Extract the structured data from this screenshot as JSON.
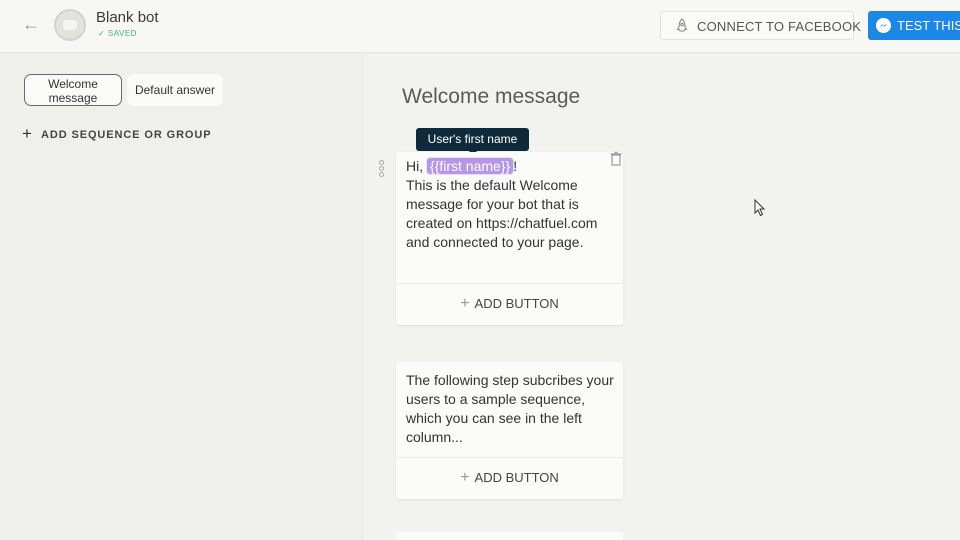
{
  "header": {
    "back_label": "←",
    "bot_name": "Blank bot",
    "saved_status": "✓ SAVED",
    "connect_label": "CONNECT TO FACEBOOK",
    "test_label": "TEST THIS C"
  },
  "sidebar": {
    "chips": [
      {
        "label_line1": "Welcome",
        "label_line2": "message"
      },
      {
        "label": "Default answer"
      }
    ],
    "add_sequence_plus": "+",
    "add_sequence_label": "ADD SEQUENCE OR GROUP"
  },
  "main": {
    "title": "Welcome message",
    "tooltip": "User's first name",
    "cards": [
      {
        "greeting": "Hi,",
        "variable": "{{first name}}",
        "punct": "!",
        "body": "This is the default Welcome message for your bot that is created on https://chatfuel.com and connected to your page.",
        "add_button": "ADD BUTTON"
      },
      {
        "body": "The following step subcribes your users to a sample sequence, which you can see in the left column...",
        "add_button": "ADD BUTTON"
      }
    ],
    "add_plus": "+"
  },
  "icons": {
    "back": "arrow-left-icon",
    "avatar": "bot-avatar-icon",
    "connect": "rocket-icon",
    "test": "messenger-icon",
    "trash": "trash-icon",
    "drag": "drag-handle-icon"
  },
  "colors": {
    "accent_blue": "#1b87e6",
    "saved_green": "#3fb37f",
    "tooltip_bg": "#0f2a3a",
    "variable_chip": "#b696e8"
  }
}
